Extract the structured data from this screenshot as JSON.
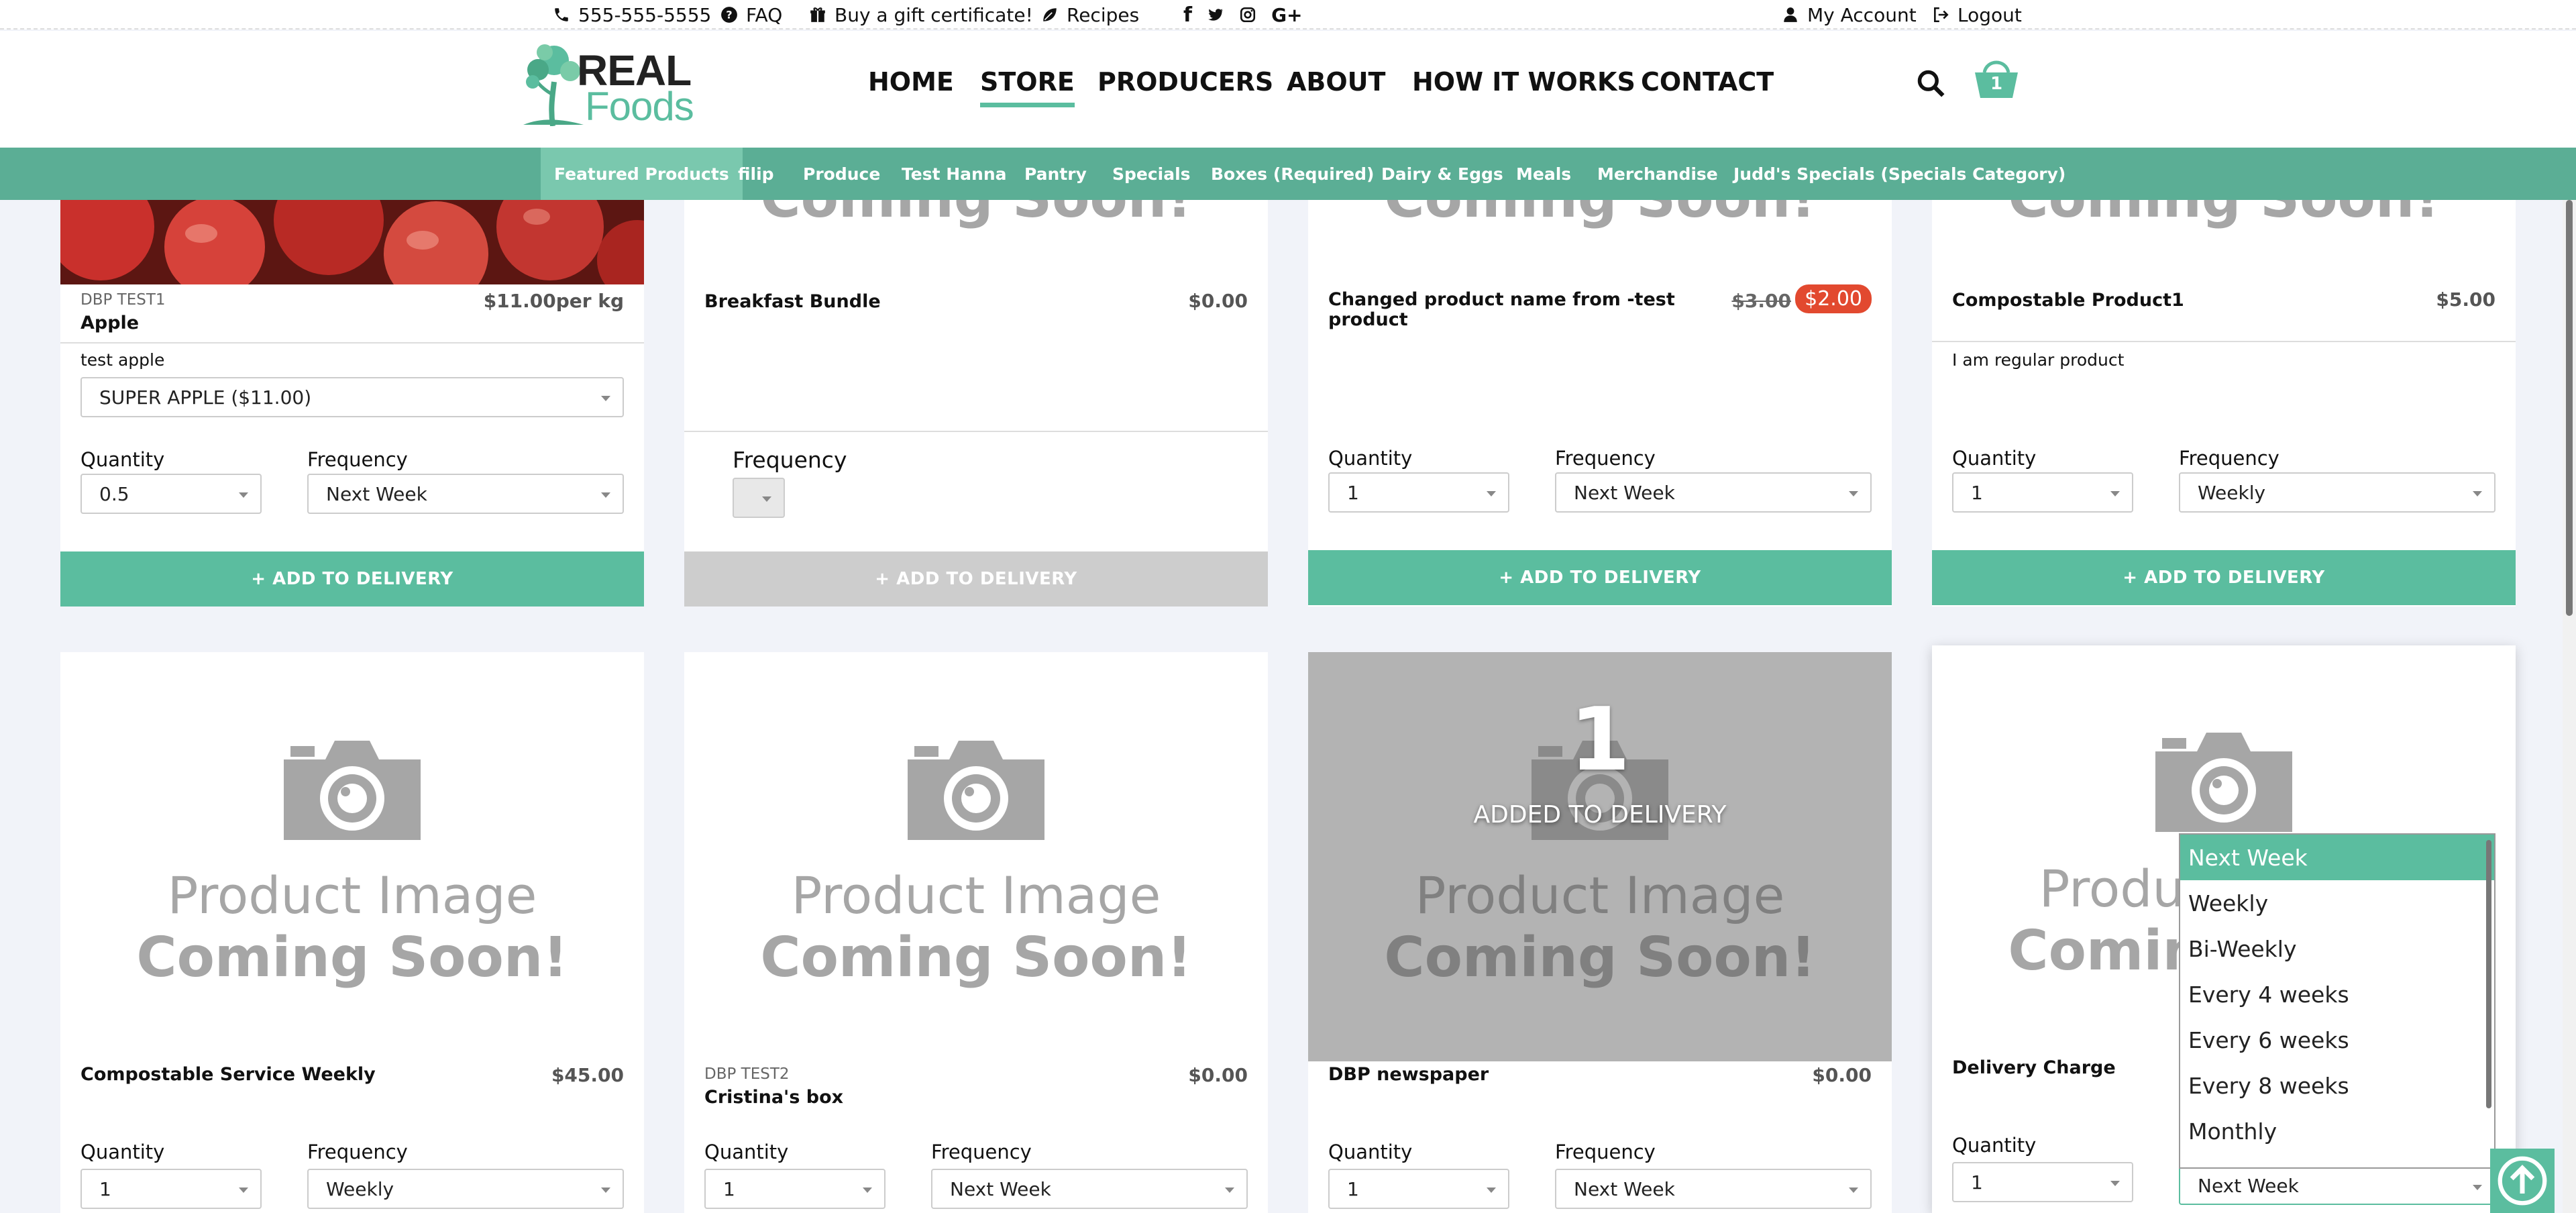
{
  "topbar": {
    "phone": "555-555-5555",
    "faq": "FAQ",
    "gift": "Buy a gift certificate!",
    "recipes": "Recipes",
    "account": "My Account",
    "logout": "Logout"
  },
  "logo": {
    "line1": "REAL",
    "line2": "Foods"
  },
  "nav": [
    "HOME",
    "STORE",
    "PRODUCERS",
    "ABOUT",
    "HOW IT WORKS",
    "CONTACT"
  ],
  "cart_count": "1",
  "categories": [
    "Featured Products",
    "filip",
    "Produce",
    "Test Hanna",
    "Pantry",
    "Specials",
    "Boxes (Required)",
    "Dairy & Eggs",
    "Meals",
    "Merchandise",
    "Judd's Specials (Specials Category)"
  ],
  "placeholder": {
    "line1": "Product Image",
    "line2": "Coming Soon!"
  },
  "labels": {
    "quantity": "Quantity",
    "frequency": "Frequency",
    "add": "ADD TO DELIVERY"
  },
  "row1": [
    {
      "sku": "DBP TEST1",
      "name": "Apple",
      "price": "$11.00per kg",
      "desc": "test apple",
      "option": "SUPER APPLE ($11.00)",
      "qty": "0.5",
      "freq": "Next Week"
    },
    {
      "name": "Breakfast Bundle",
      "price": "$0.00"
    },
    {
      "name": "Changed product name from -test product",
      "old_price": "$3.00",
      "price": "$2.00",
      "qty": "1",
      "freq": "Next Week"
    },
    {
      "name": "Compostable Product1",
      "price": "$5.00",
      "desc": "I am regular product",
      "qty": "1",
      "freq": "Weekly"
    }
  ],
  "row2": [
    {
      "name": "Compostable Service Weekly",
      "price": "$45.00",
      "qty": "1",
      "freq": "Weekly"
    },
    {
      "sku": "DBP TEST2",
      "name": "Cristina's box",
      "price": "$0.00",
      "qty": "1",
      "freq": "Next Week"
    },
    {
      "name": "DBP newspaper",
      "price": "$0.00",
      "qty": "1",
      "freq": "Next Week",
      "added_count": "1",
      "added_text": "ADDED TO DELIVERY"
    },
    {
      "name": "Delivery Charge",
      "qty": "1",
      "freq": "Next Week"
    }
  ],
  "dropdown_options": [
    "Next Week",
    "Weekly",
    "Bi-Weekly",
    "Every 4 weeks",
    "Every 6 weeks",
    "Every 8 weeks",
    "Monthly"
  ],
  "colors": {
    "accent": "#5bbd9f",
    "catbar": "#5bae95",
    "sale": "#e2492f"
  }
}
